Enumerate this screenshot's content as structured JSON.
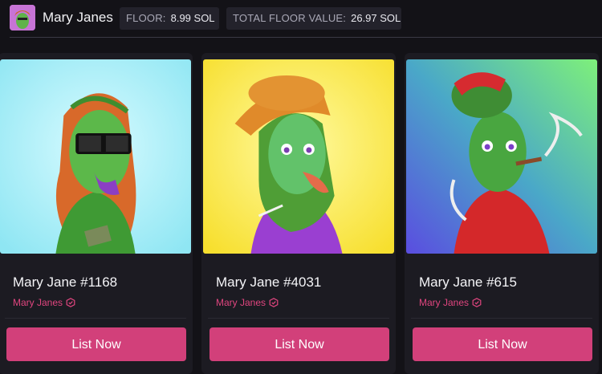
{
  "collection": {
    "title": "Mary Janes",
    "logo_icon": "collection-avatar-icon"
  },
  "stats": {
    "floor_label": "FLOOR:",
    "floor_value": "8.99 SOL",
    "total_label": "TOTAL FLOOR VALUE:",
    "total_value": "26.97 SOL"
  },
  "colors": {
    "background": "#131217",
    "card": "#1c1b22",
    "accent": "#d2407a",
    "collection_link": "#e0457f"
  },
  "cards": [
    {
      "name": "Mary Jane #1168",
      "collection": "Mary Janes",
      "button": "List Now",
      "art_bg": "light-cyan"
    },
    {
      "name": "Mary Jane #4031",
      "collection": "Mary Janes",
      "button": "List Now",
      "art_bg": "yellow"
    },
    {
      "name": "Mary Jane #615",
      "collection": "Mary Janes",
      "button": "List Now",
      "art_bg": "purple-green-gradient"
    }
  ]
}
